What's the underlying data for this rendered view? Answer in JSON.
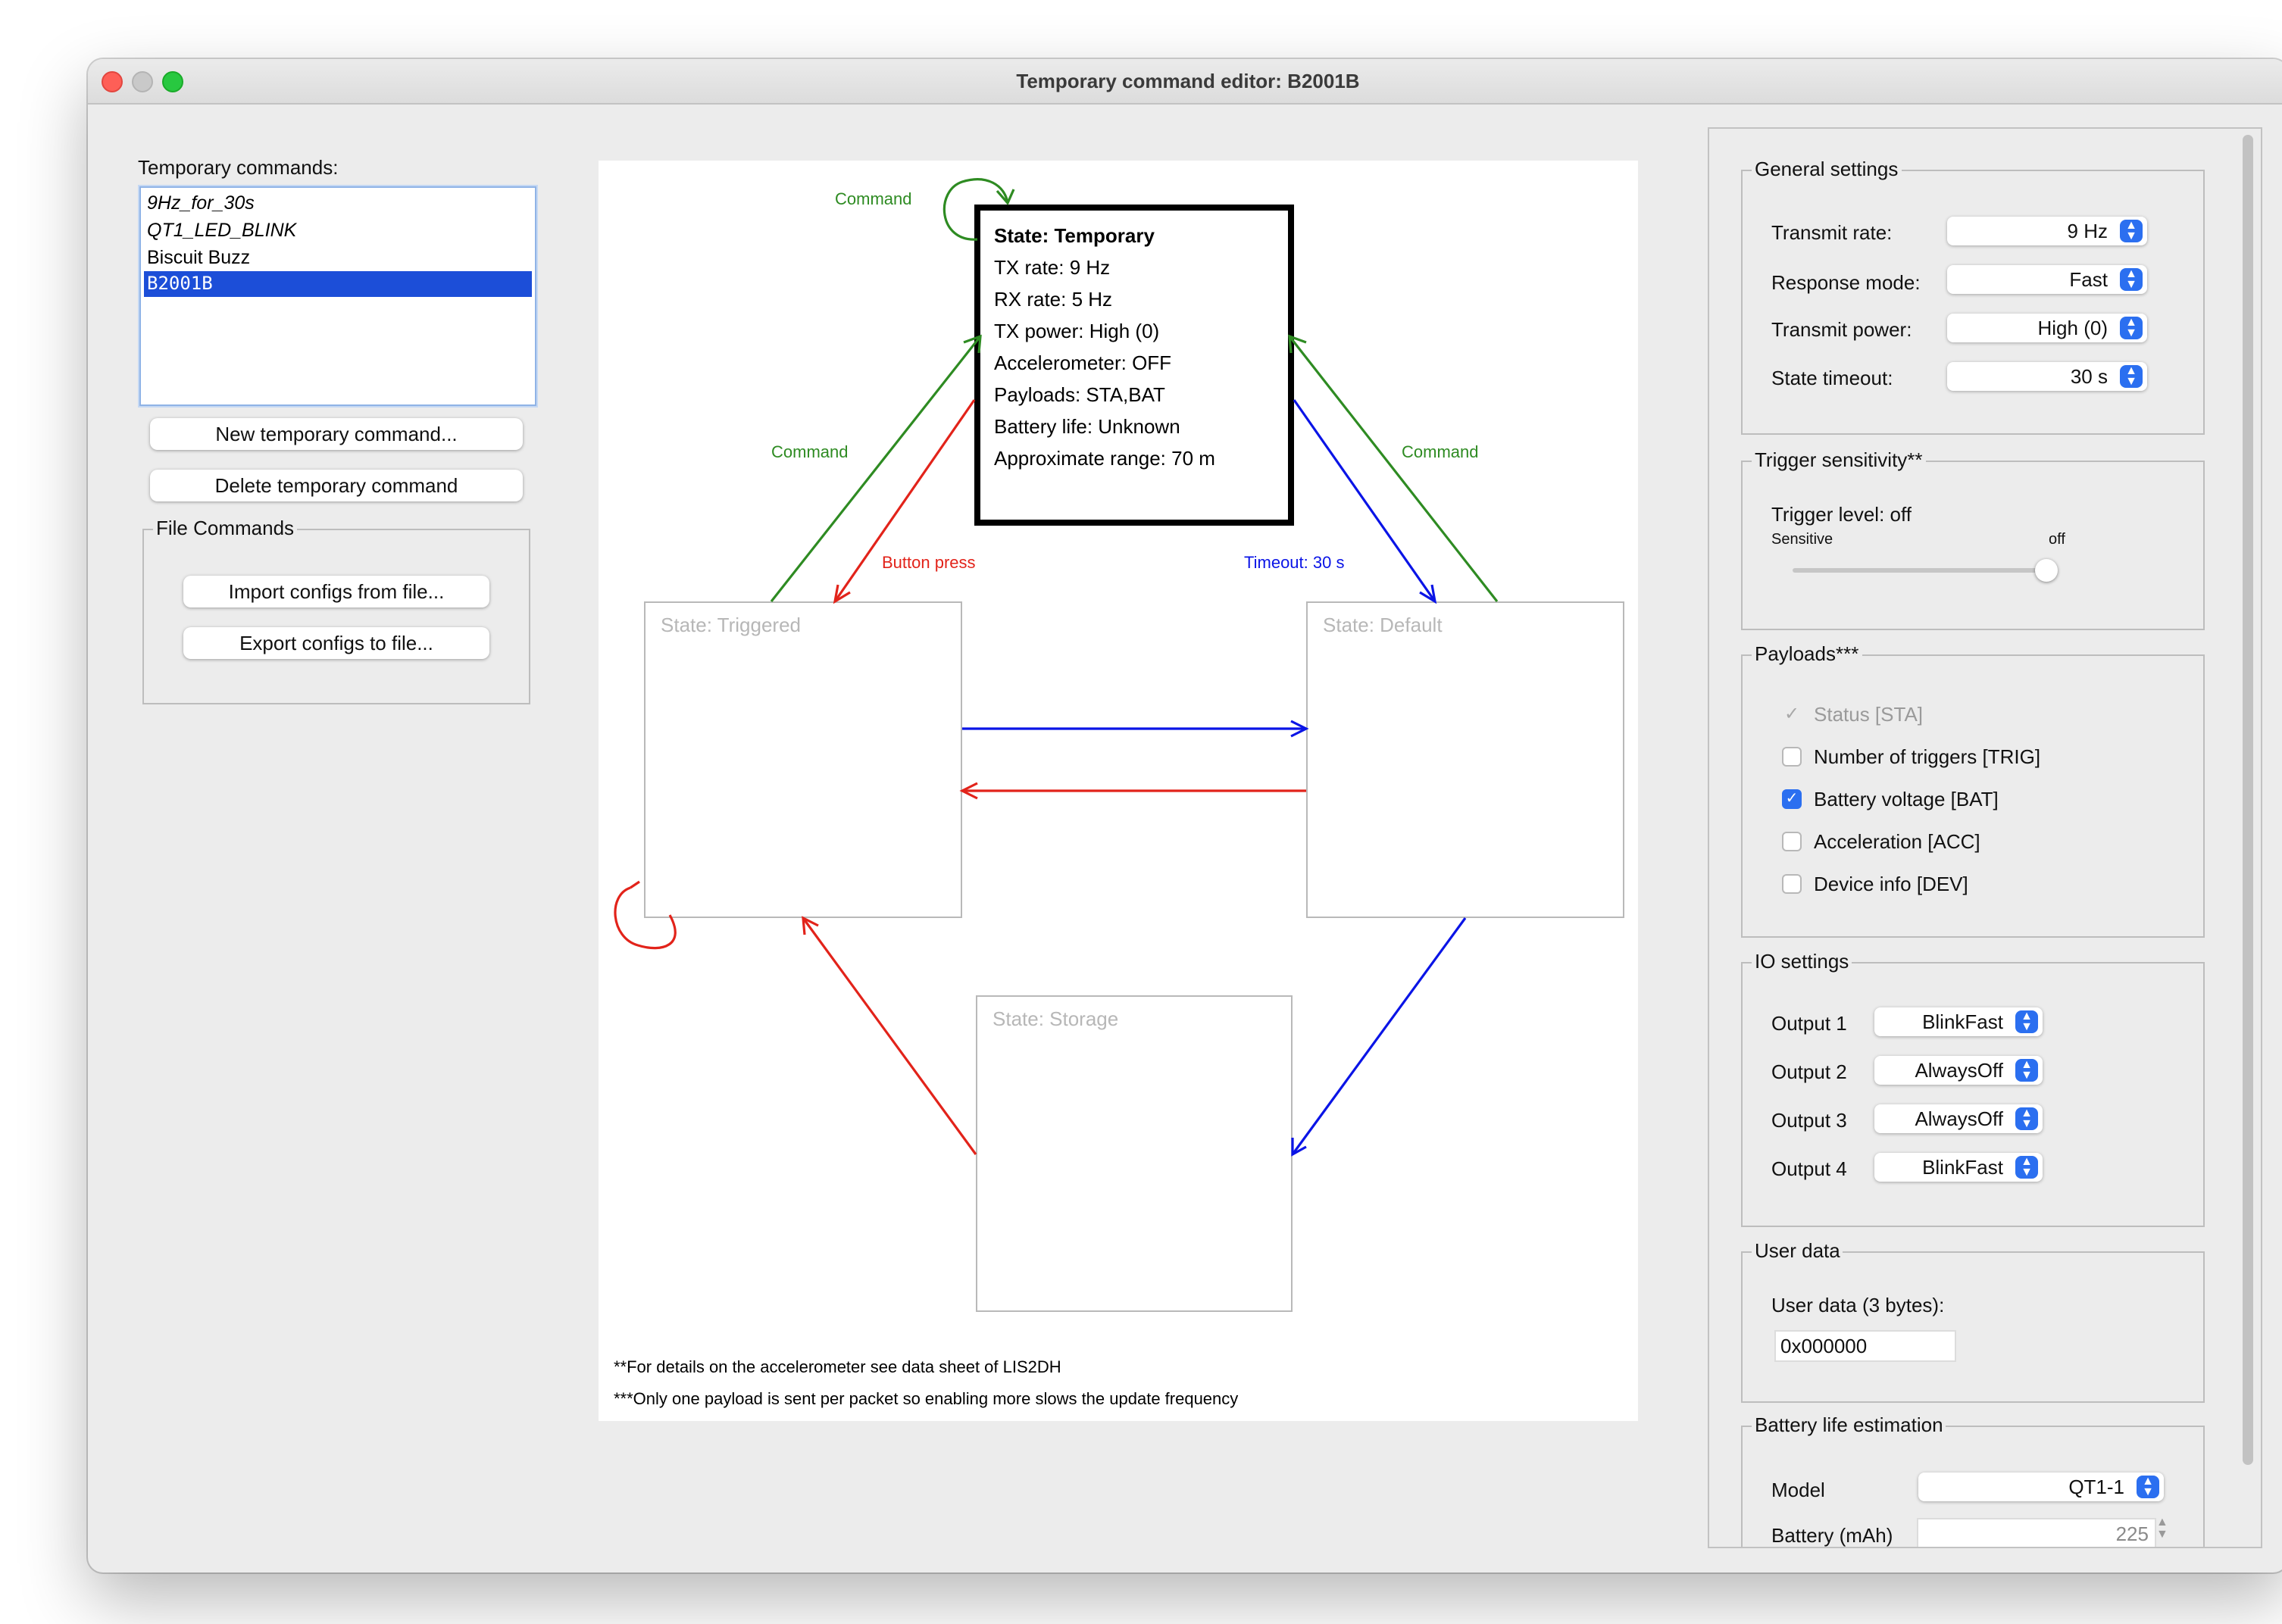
{
  "window": {
    "title": "Temporary command editor:  B2001B"
  },
  "left": {
    "list_label": "Temporary commands:",
    "items": [
      {
        "label": "9Hz_for_30s"
      },
      {
        "label": "QT1_LED_BLINK"
      },
      {
        "label": "Biscuit Buzz"
      },
      {
        "label": "B2001B"
      }
    ],
    "selected_item": "B2001B",
    "new_button": "New temporary command...",
    "delete_button": "Delete temporary command",
    "file_commands": {
      "title": "File Commands",
      "import_button": "Import configs from file...",
      "export_button": "Export configs to file..."
    }
  },
  "diagram": {
    "temporary": {
      "lines": [
        "State: Temporary",
        "TX rate: 9 Hz",
        "RX rate: 5 Hz",
        "TX power: High (0)",
        "Accelerometer: OFF",
        "Payloads: STA,BAT",
        "Battery life: Unknown",
        "Approximate range: 70 m"
      ]
    },
    "triggered_label": "State: Triggered",
    "default_label": "State: Default",
    "storage_label": "State: Storage",
    "arrow_labels": {
      "self_loop": "Command",
      "left_command": "Command",
      "right_command": "Command",
      "button_press": "Button press",
      "timeout": "Timeout: 30 s"
    },
    "colors": {
      "command": "#2e8b22",
      "button": "#e2231a",
      "timeout": "#0a14e6"
    },
    "footnote1": "**For details on the accelerometer see data sheet of LIS2DH",
    "footnote2": "***Only one payload is sent per packet so enabling more slows the update frequency"
  },
  "general": {
    "title": "General settings",
    "transmit_rate_label": "Transmit rate:",
    "transmit_rate": "9 Hz",
    "response_mode_label": "Response mode:",
    "response_mode": "Fast",
    "transmit_power_label": "Transmit power:",
    "transmit_power": "High (0)",
    "state_timeout_label": "State timeout:",
    "state_timeout": "30 s"
  },
  "trigger": {
    "title": "Trigger sensitivity**",
    "level_label": "Trigger level: off",
    "min_label": "Sensitive",
    "max_label": "off",
    "level_fraction": 1.0
  },
  "payloads": {
    "title": "Payloads***",
    "items": [
      {
        "label": "Status [STA]",
        "checked": true,
        "disabled": true
      },
      {
        "label": "Number of triggers [TRIG]",
        "checked": false,
        "disabled": false
      },
      {
        "label": "Battery voltage [BAT]",
        "checked": true,
        "disabled": false
      },
      {
        "label": "Acceleration [ACC]",
        "checked": false,
        "disabled": false
      },
      {
        "label": "Device info [DEV]",
        "checked": false,
        "disabled": false
      }
    ]
  },
  "io": {
    "title": "IO settings",
    "outputs": [
      {
        "label": "Output 1",
        "value": "BlinkFast"
      },
      {
        "label": "Output 2",
        "value": "AlwaysOff"
      },
      {
        "label": "Output 3",
        "value": "AlwaysOff"
      },
      {
        "label": "Output 4",
        "value": "BlinkFast"
      }
    ]
  },
  "user_data": {
    "title": "User data",
    "label": "User data (3 bytes):",
    "value": "0x000000"
  },
  "battery": {
    "title": "Battery life estimation",
    "model_label": "Model",
    "model": "QT1-1",
    "capacity_label": "Battery (mAh)",
    "capacity": "225"
  }
}
